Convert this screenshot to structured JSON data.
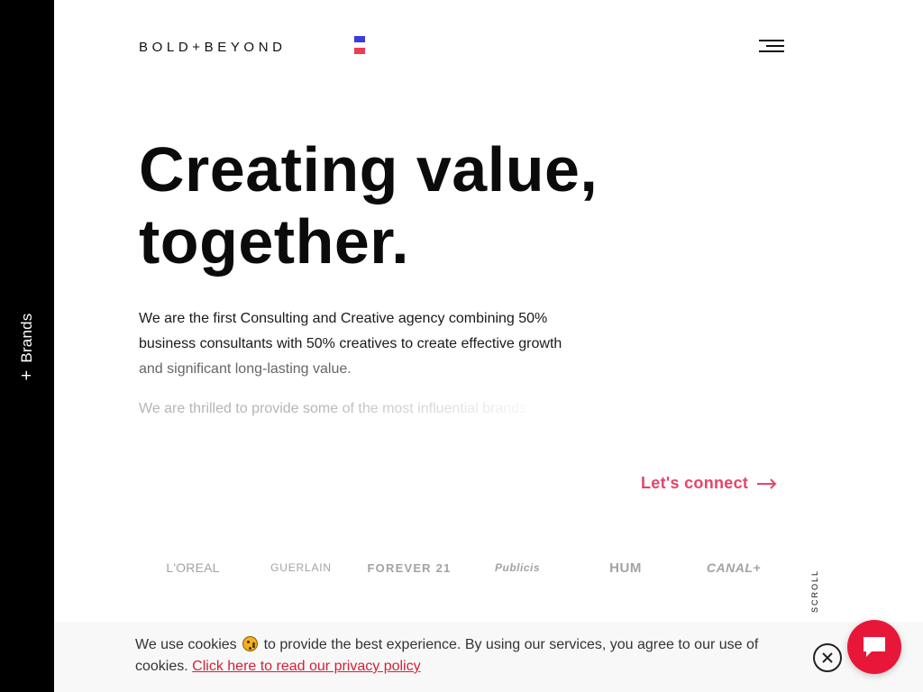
{
  "sidebar": {
    "label": "Brands",
    "plus": "+",
    "background": "#000000"
  },
  "header": {
    "logo": "BOLD+BEYOND",
    "flag_colors": [
      "#3b3be0",
      "#ffffff",
      "#ef3b54"
    ],
    "menu_icon": "hamburger-menu-icon"
  },
  "hero": {
    "title_line1": "Creating value,",
    "title_line2": "together.",
    "intro_part1": "We are the first Consulting and Creative agency combining 50% business consultants with 50% creatives to create effective growth",
    "intro_part2": "and significant long-lasting value.",
    "intro2": "We are thrilled to provide some of the most influential brands"
  },
  "cta": {
    "label": "Let's connect",
    "color": "#e8436a",
    "icon": "arrow-right-icon"
  },
  "brands": [
    "L'OREAL",
    "GUERLAIN",
    "FOREVER 21",
    "Publicis",
    "HUM",
    "CANAL+"
  ],
  "scroll": {
    "label": "SCROLL"
  },
  "cookie": {
    "text_before": "We use cookies",
    "emoji": "cookie-icon",
    "text_after": "to provide the best experience. By using our services, you agree to our use of cookies.",
    "link": "Click here to read our privacy policy",
    "link_color": "#d6203b",
    "close_icon": "close-icon"
  },
  "chat": {
    "icon": "chat-bubble-icon",
    "color": "#e8173a"
  }
}
